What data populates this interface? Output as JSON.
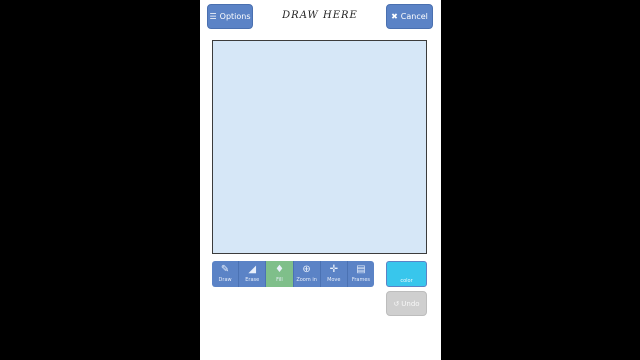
{
  "header": {
    "options_icon": "menu-icon",
    "options_label": "Options",
    "title": "DRAW HERE",
    "cancel_icon": "close-icon",
    "cancel_label": "Cancel"
  },
  "toolbar": {
    "tools": [
      {
        "label": "Draw",
        "icon": "pencil-icon",
        "glyph": "✎"
      },
      {
        "label": "Erase",
        "icon": "eraser-icon",
        "glyph": "◢"
      },
      {
        "label": "Fill",
        "icon": "fill-drop-icon",
        "glyph": "♦"
      },
      {
        "label": "Zoom in",
        "icon": "zoom-in-icon",
        "glyph": "⊕"
      },
      {
        "label": "Move",
        "icon": "move-icon",
        "glyph": "✛"
      },
      {
        "label": "Frames",
        "icon": "frames-icon",
        "glyph": "▤"
      }
    ],
    "active_tool": "Fill"
  },
  "color_button": {
    "label": "color",
    "value": "#38c6ec"
  },
  "undo": {
    "label": "Undo",
    "icon": "undo-icon",
    "enabled": false
  },
  "colors": {
    "accent": "#5b83c6",
    "canvas": "#d6e7f7",
    "active_tool": "#7fbf8a",
    "background": "#000000"
  }
}
